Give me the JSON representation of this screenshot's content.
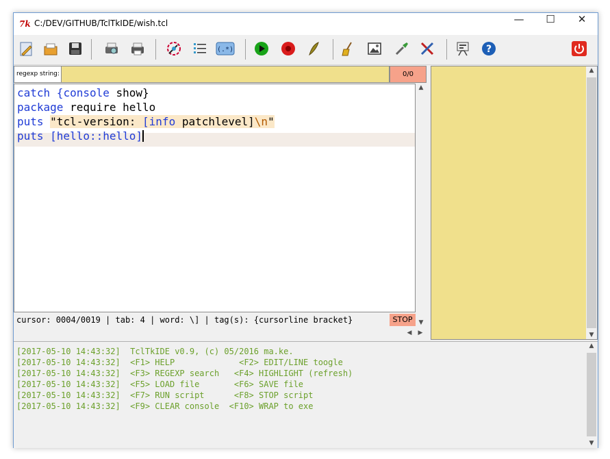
{
  "window": {
    "title": "C:/DEV/GITHUB/TclTkIDE/wish.tcl",
    "app_icon_text": "7k",
    "minimize_glyph": "—",
    "maximize_glyph": "☐",
    "close_glyph": "✕"
  },
  "toolbar": {
    "buttons": [
      {
        "icon": "new-file-icon"
      },
      {
        "icon": "open-file-icon"
      },
      {
        "icon": "save-icon"
      },
      {
        "icon": "print-preview-icon"
      },
      {
        "icon": "print-icon"
      },
      {
        "icon": "color-picker-icon"
      },
      {
        "icon": "list-icon"
      },
      {
        "icon": "regexp-icon",
        "label": "(.*)"
      },
      {
        "icon": "run-icon"
      },
      {
        "icon": "stop-icon"
      },
      {
        "icon": "quill-icon"
      },
      {
        "icon": "broom-icon"
      },
      {
        "icon": "image-icon"
      },
      {
        "icon": "pipette-icon"
      },
      {
        "icon": "tools-icon"
      },
      {
        "icon": "settings-icon"
      },
      {
        "icon": "help-icon",
        "label": "?"
      },
      {
        "icon": "power-icon"
      }
    ]
  },
  "search": {
    "label": "regexp string:",
    "value": "",
    "match_count": "0/0"
  },
  "editor": {
    "lines": [
      {
        "t1": "catch",
        "t2": " {console",
        "t3": " show}"
      },
      {
        "t1": "package",
        "t2": " require hello"
      },
      {
        "t1": "puts",
        "t2": "\"tcl-version: ",
        "t3": "[info",
        "t4": " patchlevel]",
        "t5": "\\n",
        "t6": "\""
      },
      {
        "t1": "puts",
        "t2": " [hello::hello]"
      }
    ]
  },
  "status": {
    "text": "cursor: 0004/0019 | tab: 4 | word: \\] | tag(s): {cursorline bracket}",
    "stop_label": "STOP"
  },
  "console": {
    "lines": [
      "[2017-05-10 14:43:32]  TclTkIDE v0.9, (c) 05/2016 ma.ke.",
      "[2017-05-10 14:43:32]  <F1> HELP             <F2> EDIT/LINE toogle",
      "[2017-05-10 14:43:32]  <F3> REGEXP search   <F4> HIGHLIGHT (refresh)",
      "[2017-05-10 14:43:32]  <F5> LOAD file       <F6> SAVE file",
      "[2017-05-10 14:43:32]  <F7> RUN script      <F8> STOP script",
      "[2017-05-10 14:43:32]  <F9> CLEAR console  <F10> WRAP to exe"
    ]
  },
  "colors": {
    "search_bg": "#f0e08c",
    "match_bg": "#f6a28a",
    "keyword": "#1f3bd6",
    "console_text": "#6ba02b"
  }
}
